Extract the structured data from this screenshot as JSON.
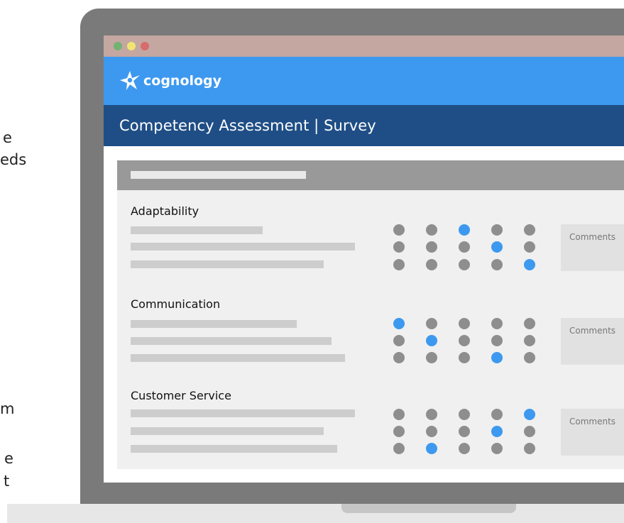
{
  "side_text": {
    "frag1": "e",
    "frag2": "eds",
    "frag3": "m",
    "frag4": "e",
    "frag5": "t"
  },
  "window": {
    "traffic_lights": [
      "green",
      "yellow",
      "red"
    ]
  },
  "brand": {
    "name": "cognology",
    "logo_icon": "star-figure-icon"
  },
  "page": {
    "title": "Competency Assessment | Survey"
  },
  "colors": {
    "brand_blue": "#3d99ef",
    "title_navy": "#1f4e86",
    "dot_gray": "#8e8e8e",
    "dot_selected": "#3d99ef"
  },
  "survey": {
    "sections": [
      {
        "title": "Adaptability",
        "comments_label": "Comments",
        "selected": [
          3,
          4,
          5
        ]
      },
      {
        "title": "Communication",
        "comments_label": "Comments",
        "selected": [
          1,
          2,
          4
        ]
      },
      {
        "title": "Customer Service",
        "comments_label": "Comments",
        "selected": [
          5,
          4,
          2
        ]
      }
    ]
  }
}
